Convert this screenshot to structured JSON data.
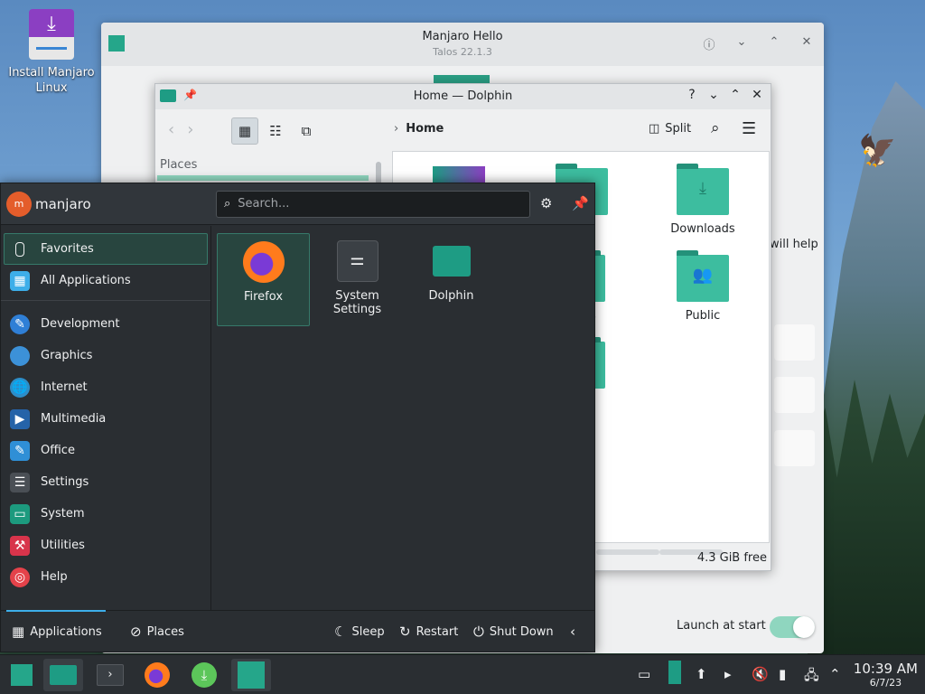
{
  "desktop": {
    "install_icon": {
      "label": "Install Manjaro Linux"
    }
  },
  "hello_window": {
    "title": "Manjaro Hello",
    "subtitle": "Talos 22.1.3",
    "help_text": "will help",
    "launch_at_start_label": "Launch at start",
    "launch_at_start_on": true
  },
  "dolphin": {
    "title": "Home — Dolphin",
    "breadcrumb": "Home",
    "split_label": "Split",
    "places_header": "Places",
    "folders": [
      {
        "name": "Downloads",
        "glyph": "⤓"
      },
      {
        "name": "Public",
        "glyph": "👥"
      }
    ],
    "partial_labels": [
      "nts",
      "es",
      "s"
    ],
    "free_space": "4.3 GiB free"
  },
  "launcher": {
    "user": "manjaro",
    "avatar_initial": "m",
    "search_placeholder": "Search...",
    "categories": [
      {
        "label": "Favorites",
        "icon": "bookmark-icon",
        "color": "#28453f"
      },
      {
        "label": "All Applications",
        "icon": "grid-icon",
        "color": "#3daee9"
      },
      {
        "label": "Development",
        "icon": "development-icon",
        "color": "#2f7fd6"
      },
      {
        "label": "Graphics",
        "icon": "graphics-icon",
        "color": "#3c91d8"
      },
      {
        "label": "Internet",
        "icon": "internet-icon",
        "color": "#2c8ec9"
      },
      {
        "label": "Multimedia",
        "icon": "multimedia-icon",
        "color": "#2563a8"
      },
      {
        "label": "Office",
        "icon": "office-icon",
        "color": "#2f8fd6"
      },
      {
        "label": "Settings",
        "icon": "settings-icon",
        "color": "#4a4f55"
      },
      {
        "label": "System",
        "icon": "system-icon",
        "color": "#1c9a7e"
      },
      {
        "label": "Utilities",
        "icon": "utilities-icon",
        "color": "#d8344b"
      },
      {
        "label": "Help",
        "icon": "help-icon",
        "color": "#e4424a"
      }
    ],
    "apps": [
      {
        "label": "Firefox",
        "icon": "firefox-icon"
      },
      {
        "label": "System Settings",
        "icon": "system-settings-icon"
      },
      {
        "label": "Dolphin",
        "icon": "dolphin-icon"
      }
    ],
    "footer": {
      "applications": "Applications",
      "places": "Places",
      "sleep": "Sleep",
      "restart": "Restart",
      "shutdown": "Shut Down"
    }
  },
  "taskbar": {
    "time": "10:39 AM",
    "date": "6/7/23"
  }
}
